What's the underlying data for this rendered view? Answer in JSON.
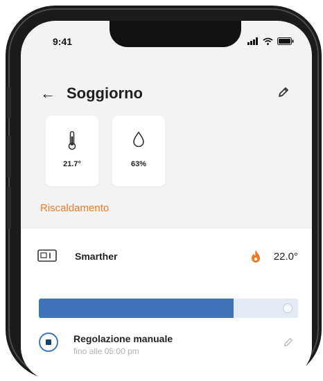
{
  "status_bar": {
    "time": "9:41"
  },
  "header": {
    "title": "Soggiorno"
  },
  "sensors": [
    {
      "icon": "thermometer-icon",
      "value": "21.7°"
    },
    {
      "icon": "water-drop-icon",
      "value": "63%"
    }
  ],
  "section": {
    "title": "Riscaldamento"
  },
  "thermostat": {
    "name": "Smarther",
    "temperature": "22.0°",
    "progress_fraction": 0.75,
    "mode": {
      "label": "Regolazione manuale",
      "sub_prefix": "fino alle",
      "sub_time": "05:00 pm"
    }
  },
  "colors": {
    "accent": "#f07a28",
    "progress": "#3f74b9"
  }
}
